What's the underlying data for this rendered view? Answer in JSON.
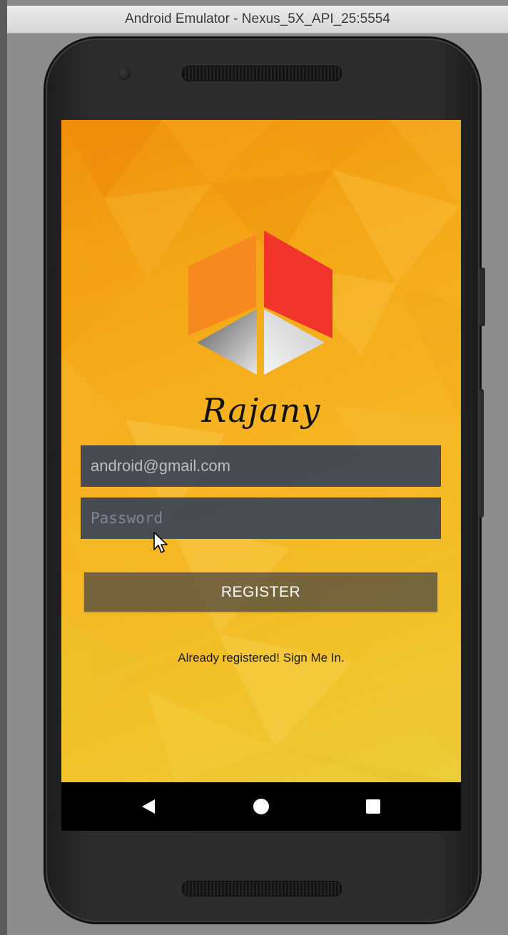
{
  "window": {
    "title": "Android Emulator - Nexus_5X_API_25:5554"
  },
  "app": {
    "brand_name": "Rajany",
    "email_value": "android@gmail.com",
    "password_placeholder": "Password",
    "register_label": "REGISTER",
    "signin_link": "Already registered! Sign Me In."
  },
  "nav": {
    "back_icon": "back-triangle-icon",
    "home_icon": "home-circle-icon",
    "recents_icon": "recents-square-icon"
  },
  "colors": {
    "accent_orange": "#f68a1e",
    "accent_red": "#f1352a",
    "field_bg": "#3e4656",
    "register_bg": "#5a5240"
  }
}
